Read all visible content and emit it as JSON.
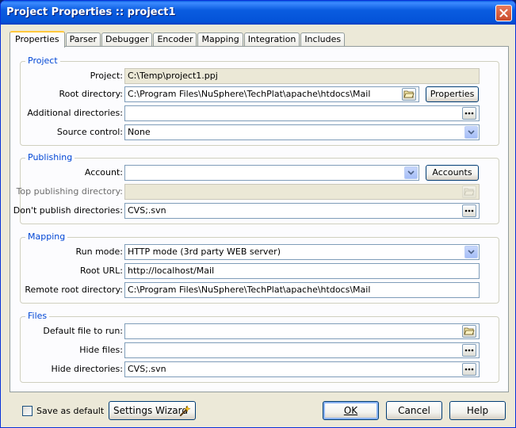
{
  "window": {
    "title": "Project Properties :: project1"
  },
  "tabs": [
    "Properties",
    "Parser",
    "Debugger",
    "Encoder",
    "Mapping",
    "Integration",
    "Includes"
  ],
  "project": {
    "group_label": "Project",
    "project_label": "Project:",
    "project_value": "C:\\Temp\\project1.ppj",
    "root_label": "Root directory:",
    "root_value": "C:\\Program Files\\NuSphere\\TechPlat\\apache\\htdocs\\Mail",
    "properties_button": "Properties",
    "additional_label": "Additional directories:",
    "additional_value": "",
    "source_label": "Source control:",
    "source_value": "None"
  },
  "publishing": {
    "group_label": "Publishing",
    "account_label": "Account:",
    "account_value": "",
    "accounts_button": "Accounts",
    "top_label": "Top publishing directory:",
    "top_value": "",
    "dont_label": "Don't publish directories:",
    "dont_value": "CVS;.svn"
  },
  "mapping": {
    "group_label": "Mapping",
    "run_label": "Run mode:",
    "run_value": "HTTP mode (3rd party WEB server)",
    "url_label": "Root URL:",
    "url_value": "http://localhost/Mail",
    "remote_label": "Remote root directory:",
    "remote_value": "C:\\Program Files\\NuSphere\\TechPlat\\apache\\htdocs\\Mail"
  },
  "files": {
    "group_label": "Files",
    "default_label": "Default file to run:",
    "default_value": "",
    "hide_files_label": "Hide files:",
    "hide_files_value": "",
    "hide_dirs_label": "Hide directories:",
    "hide_dirs_value": "CVS;.svn"
  },
  "footer": {
    "save_default_label": "Save as default",
    "wizard_label": "Settings Wizard",
    "ok_label": "OK",
    "cancel_label": "Cancel",
    "help_label": "Help"
  },
  "colors": {
    "title_bar": "#0a5ce0",
    "group_label": "#0046d5",
    "face": "#ece9d8"
  },
  "icons": [
    "close-icon",
    "folder-open-icon",
    "ellipsis-icon",
    "chevron-down-icon",
    "magic-wand-icon"
  ]
}
